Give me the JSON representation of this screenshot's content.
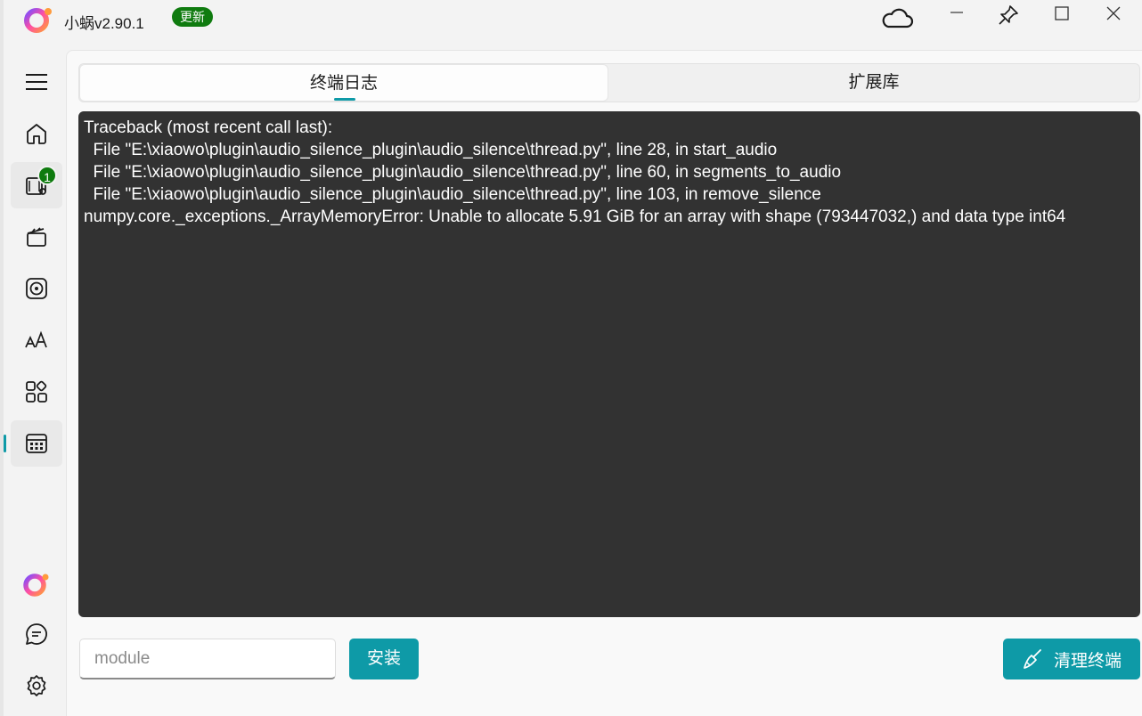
{
  "app": {
    "title": "小蜗v2.90.1",
    "update_badge": "更新",
    "logo_icon": "app-logo-icon"
  },
  "titlebar": {
    "buttons": [
      "cloud-icon",
      "minimize-icon",
      "pin-icon",
      "maximize-icon",
      "close-icon"
    ]
  },
  "sidebar": {
    "items": [
      {
        "icon": "menu-icon"
      },
      {
        "icon": "home-icon"
      },
      {
        "icon": "audio-video-icon",
        "badge": "1"
      },
      {
        "icon": "clapperboard-icon"
      },
      {
        "icon": "disc-icon"
      },
      {
        "icon": "font-size-icon"
      },
      {
        "icon": "apps-icon"
      },
      {
        "icon": "calendar-icon",
        "selected": true
      }
    ],
    "bottom": [
      {
        "icon": "app-logo-icon"
      },
      {
        "icon": "chat-icon"
      },
      {
        "icon": "settings-icon"
      }
    ]
  },
  "tabs": [
    {
      "label": "终端日志",
      "active": true
    },
    {
      "label": "扩展库",
      "active": false
    }
  ],
  "terminal": {
    "lines": [
      "Traceback (most recent call last):",
      "  File \"E:\\xiaowo\\plugin\\audio_silence_plugin\\audio_silence\\thread.py\", line 28, in start_audio",
      "  File \"E:\\xiaowo\\plugin\\audio_silence_plugin\\audio_silence\\thread.py\", line 60, in segments_to_audio",
      "  File \"E:\\xiaowo\\plugin\\audio_silence_plugin\\audio_silence\\thread.py\", line 103, in remove_silence",
      "numpy.core._exceptions._ArrayMemoryError: Unable to allocate 5.91 GiB for an array with shape (793447032,) and data type int64"
    ]
  },
  "footer": {
    "module_placeholder": "module",
    "install_label": "安装",
    "clear_label": "清理终端"
  },
  "colors": {
    "accent": "#0e9aa7",
    "badge": "#0f7b0f",
    "terminal_bg": "#323232"
  }
}
